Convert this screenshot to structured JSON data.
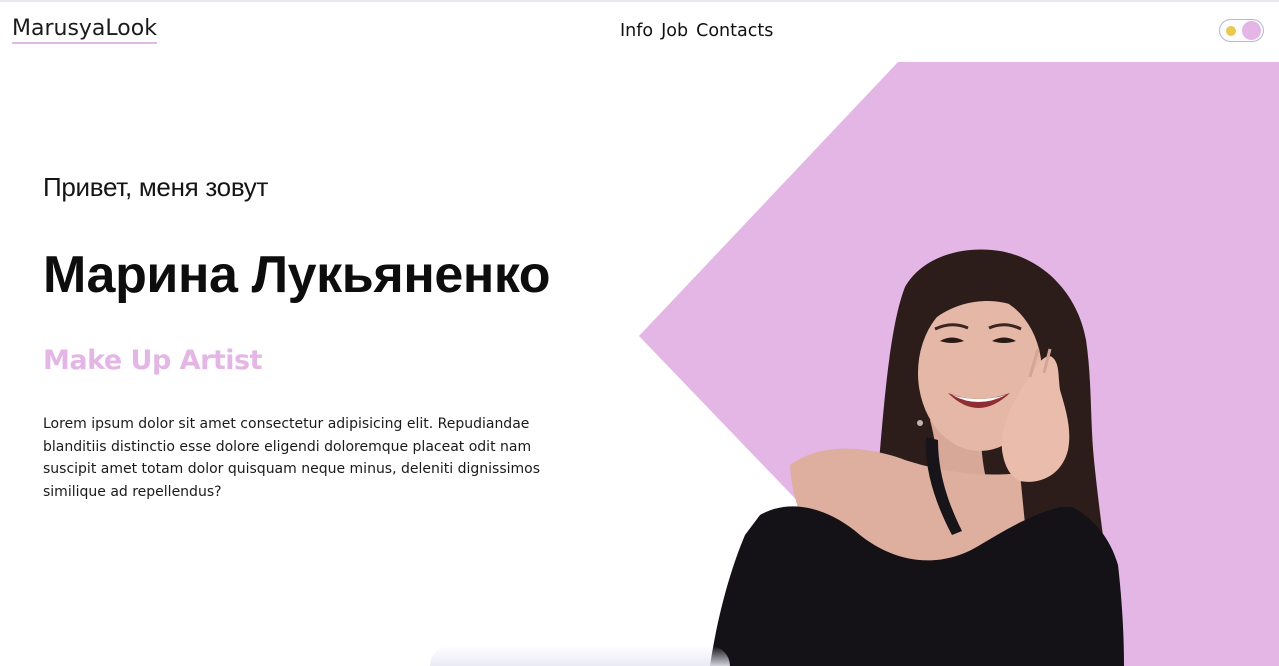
{
  "header": {
    "logo": "MarusyaLook",
    "nav": [
      {
        "label": "Info"
      },
      {
        "label": "Job"
      },
      {
        "label": "Contacts"
      }
    ],
    "theme_toggle": {
      "icon": "sun-icon",
      "state": "light"
    }
  },
  "hero": {
    "greeting": "Привет, меня зовут",
    "name": "Марина Лукьяненко",
    "role": "Make Up Artist",
    "bio": "Lorem ipsum dolor sit amet consectetur adipisicing elit. Repudiandae blanditiis distinctio esse dolore eligendi doloremque placeat odit nam suscipit amet totam dolor quisquam neque minus, deleniti dignissimos similique ad repellendus?"
  },
  "colors": {
    "accent": "#e4b6e6",
    "toggle_sun": "#e9c84c",
    "text": "#111111",
    "background": "#ffffff"
  }
}
